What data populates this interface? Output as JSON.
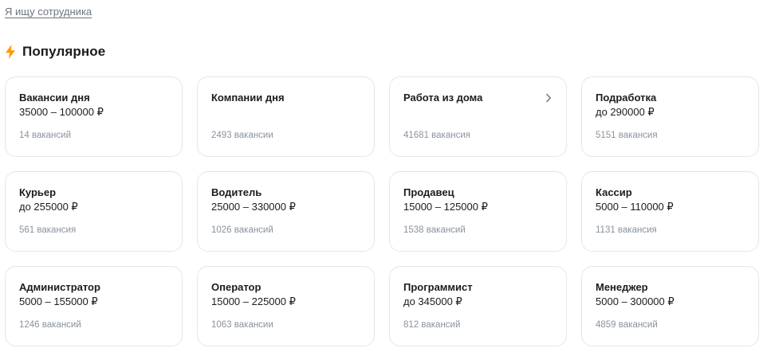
{
  "top_link": "Я ищу сотрудника",
  "section": {
    "title": "Популярное",
    "icon": "lightning-icon",
    "icon_color": "#ff9900"
  },
  "cards": [
    {
      "title": "Вакансии дня",
      "salary": "35000 – 100000 ₽",
      "count": "14 вакансий",
      "arrow": false
    },
    {
      "title": "Компании дня",
      "salary": "",
      "count": "2493 вакансии",
      "arrow": false
    },
    {
      "title": "Работа из дома",
      "salary": "",
      "count": "41681 вакансия",
      "arrow": true
    },
    {
      "title": "Подработка",
      "salary": "до 290000 ₽",
      "count": "5151 вакансия",
      "arrow": false
    },
    {
      "title": "Курьер",
      "salary": "до 255000 ₽",
      "count": "561 вакансия",
      "arrow": false
    },
    {
      "title": "Водитель",
      "salary": "25000 – 330000 ₽",
      "count": "1026 вакансий",
      "arrow": false
    },
    {
      "title": "Продавец",
      "salary": "15000 – 125000 ₽",
      "count": "1538 вакансий",
      "arrow": false
    },
    {
      "title": "Кассир",
      "salary": "5000 – 110000 ₽",
      "count": "1131 вакансия",
      "arrow": false
    },
    {
      "title": "Администратор",
      "salary": "5000 – 155000 ₽",
      "count": "1246 вакансий",
      "arrow": false
    },
    {
      "title": "Оператор",
      "salary": "15000 – 225000 ₽",
      "count": "1063 вакансии",
      "arrow": false
    },
    {
      "title": "Программист",
      "salary": "до 345000 ₽",
      "count": "812 вакансий",
      "arrow": false
    },
    {
      "title": "Менеджер",
      "salary": "5000 – 300000 ₽",
      "count": "4859 вакансий",
      "arrow": false
    }
  ]
}
